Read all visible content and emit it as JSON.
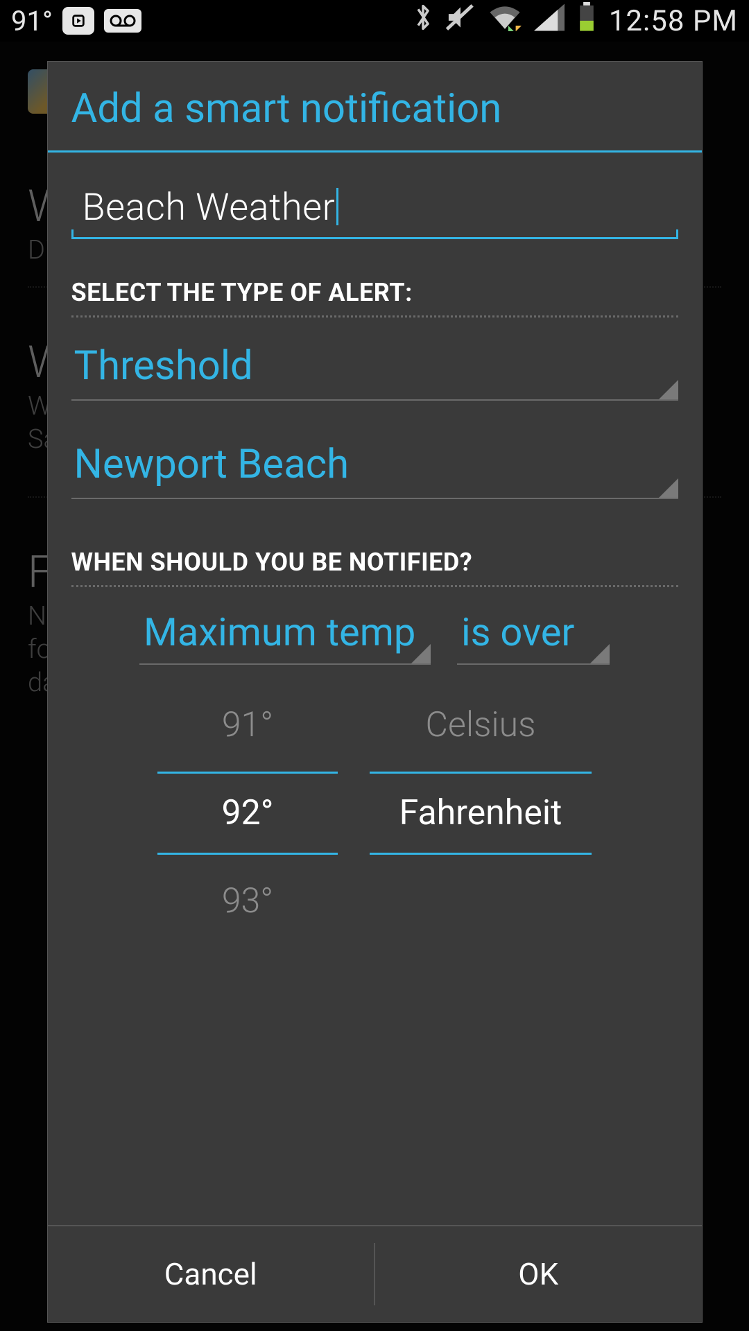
{
  "status_bar": {
    "temp": "91°",
    "clock": "12:58 PM",
    "icons": {
      "play": "play-store-icon",
      "voicemail": "voicemail-icon",
      "bluetooth": "bluetooth-icon",
      "mute": "mute-icon",
      "wifi": "wifi-icon",
      "signal": "signal-icon",
      "battery": "battery-icon"
    }
  },
  "background": {
    "row1": {
      "title_fragment": "W",
      "sub_fragment": "Di"
    },
    "row2": {
      "title_fragment": "W",
      "sub_fragment_1": "W",
      "sub_fragment_2": "Sa"
    },
    "row3": {
      "title_fragment": "F",
      "sub_fragment_1": "No",
      "sub_fragment_2": "fo",
      "sub_fragment_3": "da"
    }
  },
  "dialog": {
    "title": "Add a smart notification",
    "name_input": "Beach Weather",
    "section_type_label": "SELECT THE TYPE OF ALERT:",
    "alert_type": "Threshold",
    "location": "Newport Beach",
    "section_when_label": "WHEN SHOULD YOU BE NOTIFIED?",
    "condition_metric": "Maximum temp",
    "condition_comparator": "is over",
    "temp_picker": {
      "above": "91°",
      "selected": "92°",
      "below": "93°"
    },
    "unit_picker": {
      "above": "Celsius",
      "selected": "Fahrenheit",
      "below": ""
    },
    "buttons": {
      "cancel": "Cancel",
      "ok": "OK"
    }
  }
}
